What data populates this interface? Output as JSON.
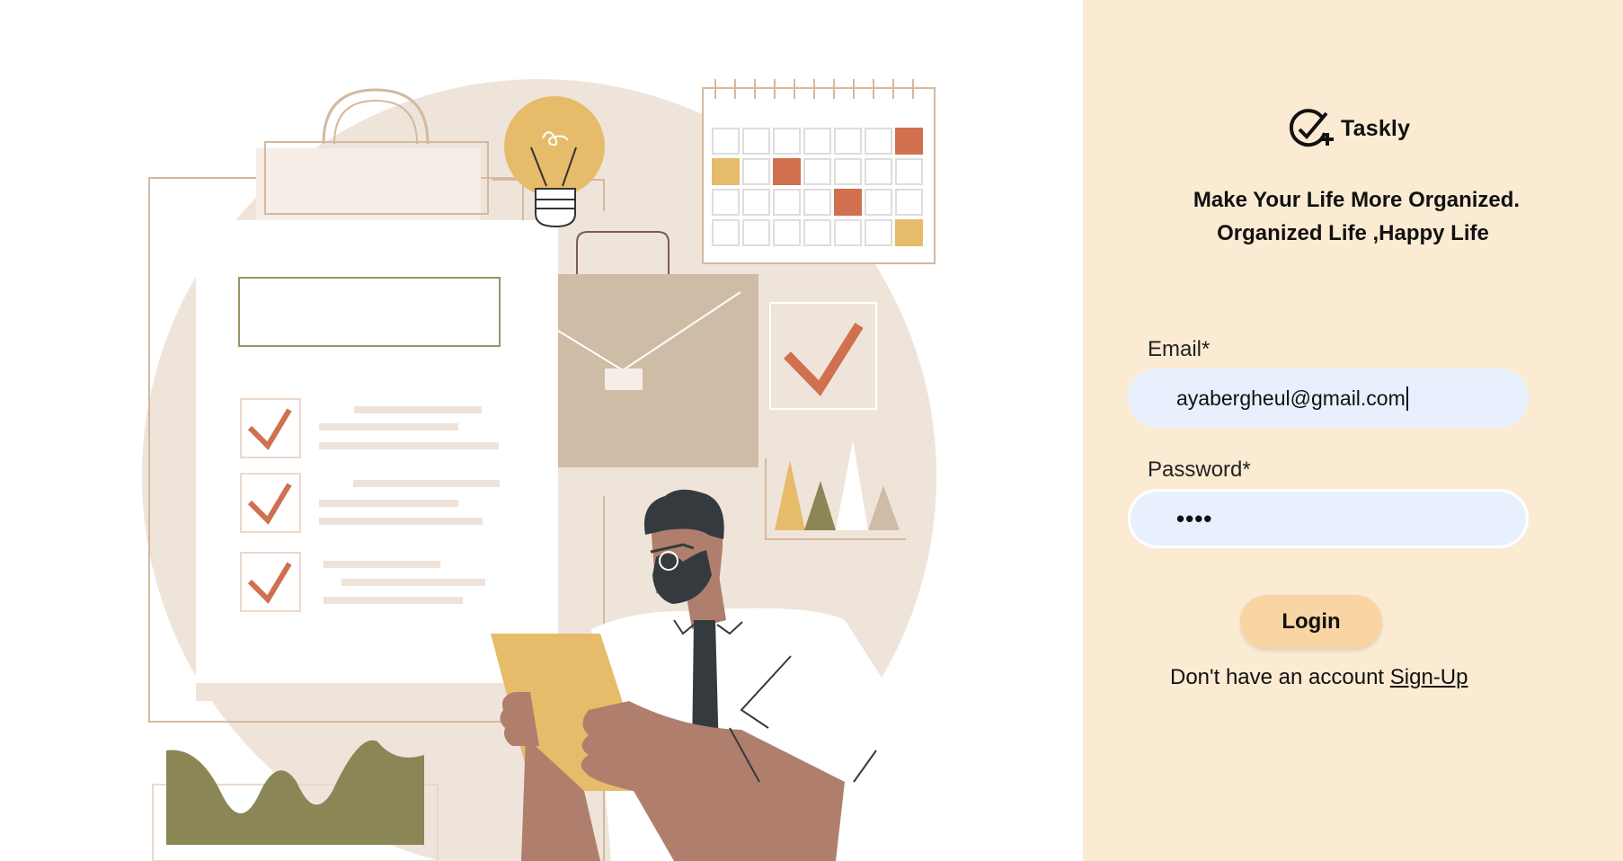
{
  "brand": {
    "name": "Taskly",
    "logo_icon": "check-plus-icon"
  },
  "tagline": {
    "line1": "Make Your Life More Organized.",
    "line2": "Organized Life ,Happy Life"
  },
  "form": {
    "email_label": "Email*",
    "email_value": "ayabergheul@gmail.com",
    "password_label": "Password*",
    "password_masked": "••••",
    "login_label": "Login",
    "signup_prompt": "Don't have an account ",
    "signup_link": "Sign-Up"
  },
  "colors": {
    "panel_bg": "#fcebd3",
    "input_bg": "#e8f0fe",
    "button_bg": "#f8d5a3",
    "accent_orange": "#d0704f",
    "accent_yellow": "#e6bb6a",
    "accent_olive": "#8a8656"
  }
}
